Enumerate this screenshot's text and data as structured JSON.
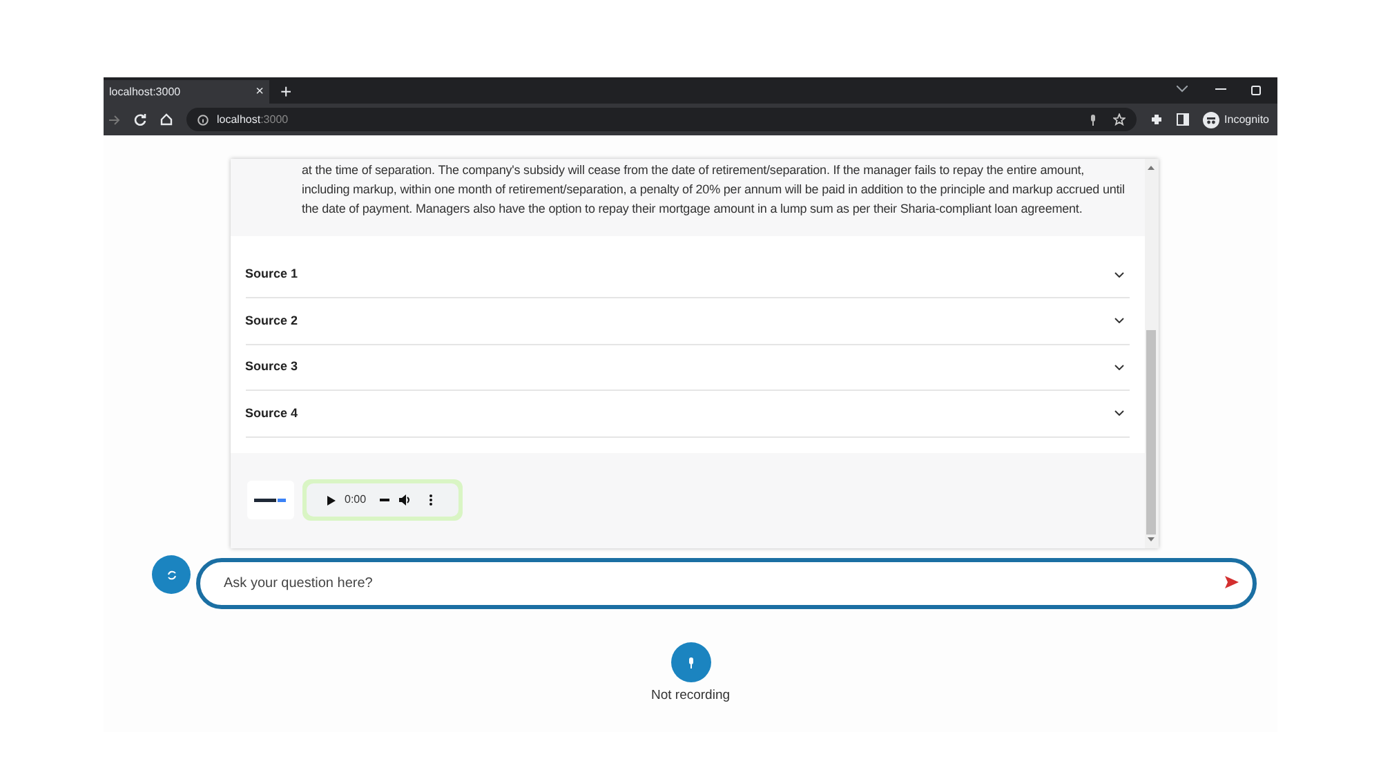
{
  "browser": {
    "tab_title": "localhost:3000",
    "tab_close": "×",
    "new_tab": "+",
    "url_host": "localhost",
    "url_port": ":3000",
    "profile": "Incognito"
  },
  "answer": {
    "text": "at the time of separation. The company's subsidy will cease from the date of retirement/separation. If the manager fails to repay the entire amount, including markup, within one month of retirement/separation, a penalty of 20% per annum will be paid in addition to the principle and markup accrued until the date of payment. Managers also have the option to repay their mortgage amount in a lump sum as per their Sharia-compliant loan agreement."
  },
  "sources": [
    {
      "label": "Source 1",
      "expanded": false
    },
    {
      "label": "Source 2",
      "expanded": false
    },
    {
      "label": "Source 3",
      "expanded": false
    },
    {
      "label": "Source 4",
      "expanded": false
    }
  ],
  "audio_player": {
    "time": "0:00"
  },
  "question": {
    "placeholder": "Ask your question here?"
  },
  "recorder": {
    "status": "Not recording"
  }
}
